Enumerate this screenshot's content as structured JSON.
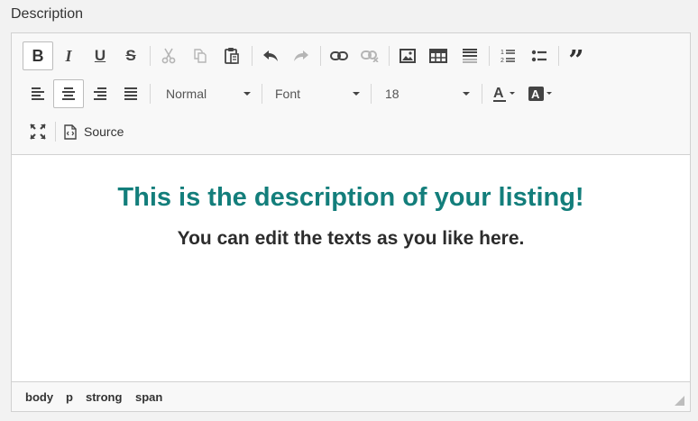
{
  "field": {
    "label": "Description"
  },
  "toolbar": {
    "format_value": "Normal",
    "font_value": "Font",
    "size_value": "18",
    "source_label": "Source"
  },
  "content": {
    "heading": "This is the description of your listing!",
    "subtext": "You can edit the texts as you like here.",
    "heading_color": "#137e7b"
  },
  "statusbar": {
    "path": [
      "body",
      "p",
      "strong",
      "span"
    ]
  }
}
